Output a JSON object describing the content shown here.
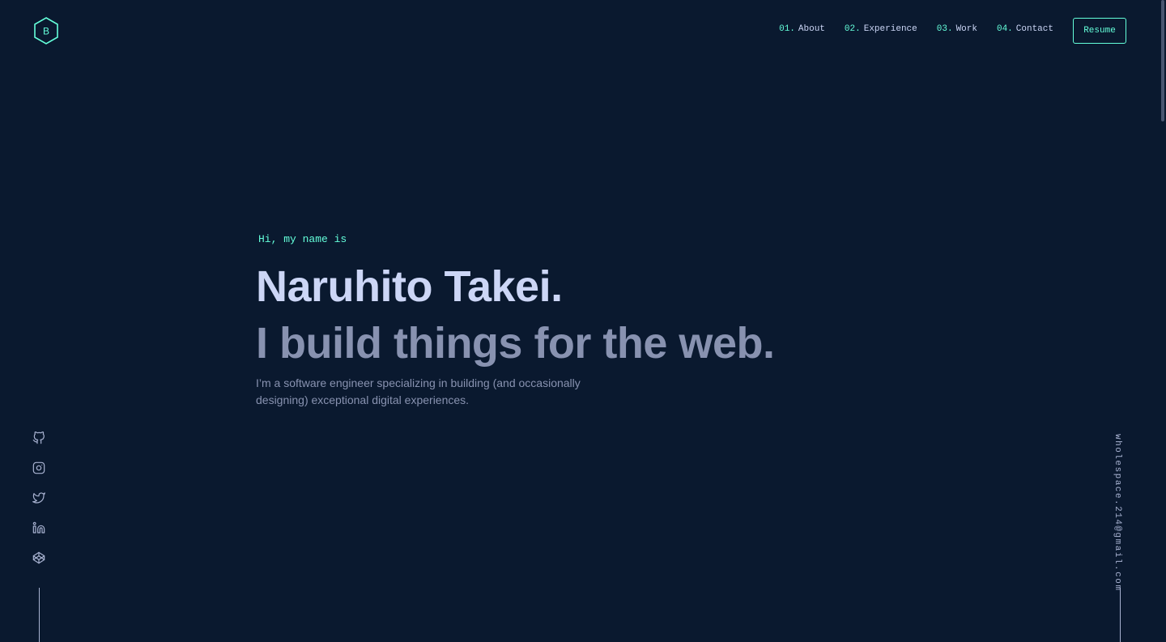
{
  "header": {
    "logo_letter": "B",
    "nav": [
      {
        "num": "01.",
        "label": "About"
      },
      {
        "num": "02.",
        "label": "Experience"
      },
      {
        "num": "03.",
        "label": "Work"
      },
      {
        "num": "04.",
        "label": "Contact"
      }
    ],
    "resume_label": "Resume"
  },
  "hero": {
    "greeting": "Hi, my name is",
    "name": "Naruhito Takei.",
    "tagline": "I build things for the web.",
    "intro": "I’m a software engineer specializing in building (and occasionally designing) exceptional digital experiences."
  },
  "social": [
    {
      "icon": "github-icon"
    },
    {
      "icon": "instagram-icon"
    },
    {
      "icon": "twitter-icon"
    },
    {
      "icon": "linkedin-icon"
    },
    {
      "icon": "codepen-icon"
    }
  ],
  "email": "wholespace.214@gmail.com",
  "colors": {
    "background": "#0a192f",
    "accent": "#64ffda",
    "heading": "#ccd6f6",
    "text": "#8892b0"
  }
}
